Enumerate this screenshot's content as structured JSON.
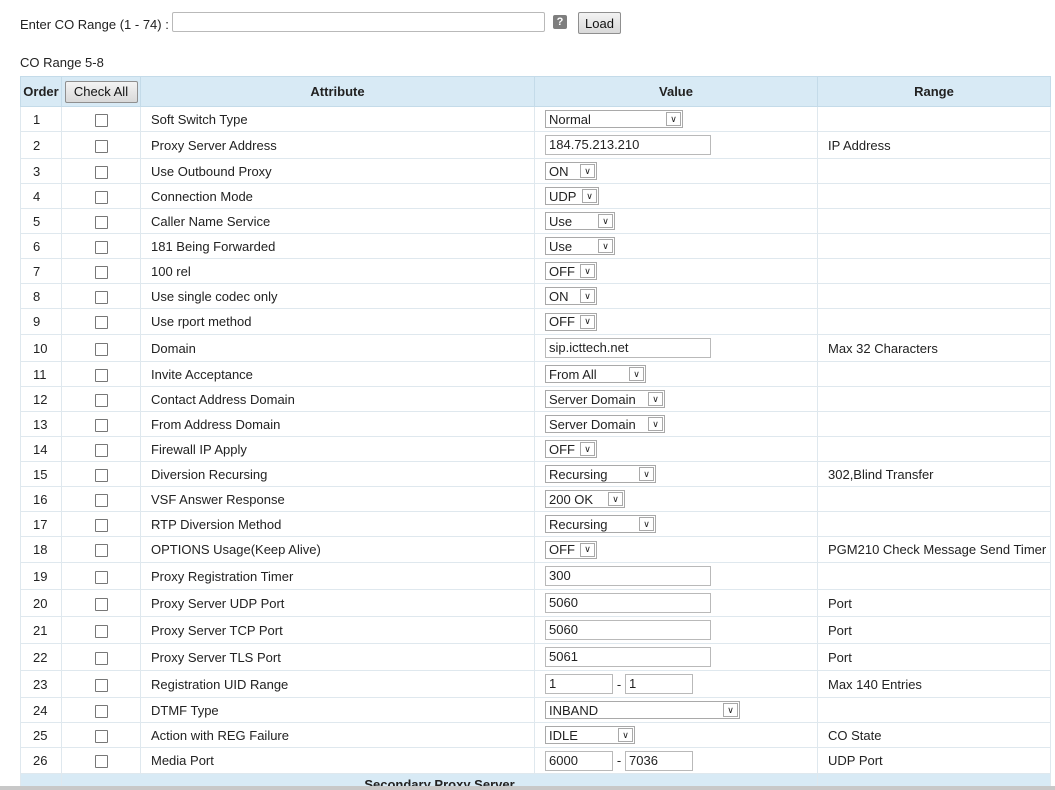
{
  "top": {
    "range_label": "Enter CO Range (1 - 74) :",
    "range_value": "",
    "load_label": "Load",
    "help_glyph": "?"
  },
  "co_range_title": "CO Range 5-8",
  "table": {
    "headers": {
      "order": "Order",
      "check_all": "Check All",
      "attribute": "Attribute",
      "value": "Value",
      "range": "Range"
    },
    "rows": [
      {
        "order": "1",
        "attribute": "Soft Switch Type",
        "type": "select",
        "value": "Normal",
        "w": 138,
        "range": ""
      },
      {
        "order": "2",
        "attribute": "Proxy Server Address",
        "type": "text",
        "value": "184.75.213.210",
        "w": 166,
        "range": "IP Address"
      },
      {
        "order": "3",
        "attribute": "Use Outbound Proxy",
        "type": "select",
        "value": "ON",
        "w": 52,
        "range": ""
      },
      {
        "order": "4",
        "attribute": "Connection Mode",
        "type": "select",
        "value": "UDP",
        "w": 54,
        "range": ""
      },
      {
        "order": "5",
        "attribute": "Caller Name Service",
        "type": "select",
        "value": "Use",
        "w": 70,
        "range": ""
      },
      {
        "order": "6",
        "attribute": "181 Being Forwarded",
        "type": "select",
        "value": "Use",
        "w": 70,
        "range": ""
      },
      {
        "order": "7",
        "attribute": "100 rel",
        "type": "select",
        "value": "OFF",
        "w": 52,
        "range": ""
      },
      {
        "order": "8",
        "attribute": "Use single codec only",
        "type": "select",
        "value": "ON",
        "w": 52,
        "range": ""
      },
      {
        "order": "9",
        "attribute": "Use rport method",
        "type": "select",
        "value": "OFF",
        "w": 52,
        "range": ""
      },
      {
        "order": "10",
        "attribute": "Domain",
        "type": "text",
        "value": "sip.icttech.net",
        "w": 166,
        "range": "Max 32 Characters"
      },
      {
        "order": "11",
        "attribute": "Invite Acceptance",
        "type": "select",
        "value": "From All",
        "w": 101,
        "range": ""
      },
      {
        "order": "12",
        "attribute": "Contact Address Domain",
        "type": "select",
        "value": "Server Domain",
        "w": 120,
        "range": ""
      },
      {
        "order": "13",
        "attribute": "From Address Domain",
        "type": "select",
        "value": "Server Domain",
        "w": 120,
        "range": ""
      },
      {
        "order": "14",
        "attribute": "Firewall IP Apply",
        "type": "select",
        "value": "OFF",
        "w": 52,
        "range": ""
      },
      {
        "order": "15",
        "attribute": "Diversion Recursing",
        "type": "select",
        "value": "Recursing",
        "w": 111,
        "range": "302,Blind Transfer"
      },
      {
        "order": "16",
        "attribute": "VSF Answer Response",
        "type": "select",
        "value": "200 OK",
        "w": 80,
        "range": ""
      },
      {
        "order": "17",
        "attribute": "RTP Diversion Method",
        "type": "select",
        "value": "Recursing",
        "w": 111,
        "range": ""
      },
      {
        "order": "18",
        "attribute": "OPTIONS Usage(Keep Alive)",
        "type": "select",
        "value": "OFF",
        "w": 52,
        "range": "PGM210 Check Message Send Timer"
      },
      {
        "order": "19",
        "attribute": "Proxy Registration Timer",
        "type": "text",
        "value": "300",
        "w": 166,
        "range": ""
      },
      {
        "order": "20",
        "attribute": "Proxy Server UDP Port",
        "type": "text",
        "value": "5060",
        "w": 166,
        "range": "Port"
      },
      {
        "order": "21",
        "attribute": "Proxy Server TCP Port",
        "type": "text",
        "value": "5060",
        "w": 166,
        "range": "Port"
      },
      {
        "order": "22",
        "attribute": "Proxy Server TLS Port",
        "type": "text",
        "value": "5061",
        "w": 166,
        "range": "Port"
      },
      {
        "order": "23",
        "attribute": "Registration UID Range",
        "type": "range",
        "value": "1",
        "value2": "1",
        "w": 68,
        "range": "Max 140 Entries"
      },
      {
        "order": "24",
        "attribute": "DTMF Type",
        "type": "select",
        "value": "INBAND",
        "w": 195,
        "range": ""
      },
      {
        "order": "25",
        "attribute": "Action with REG Failure",
        "type": "select",
        "value": "IDLE",
        "w": 90,
        "range": "CO State"
      },
      {
        "order": "26",
        "attribute": "Media Port",
        "type": "range",
        "value": "6000",
        "value2": "7036",
        "w": 68,
        "range": "UDP Port"
      }
    ],
    "footer_label": "Secondary Proxy Server"
  }
}
